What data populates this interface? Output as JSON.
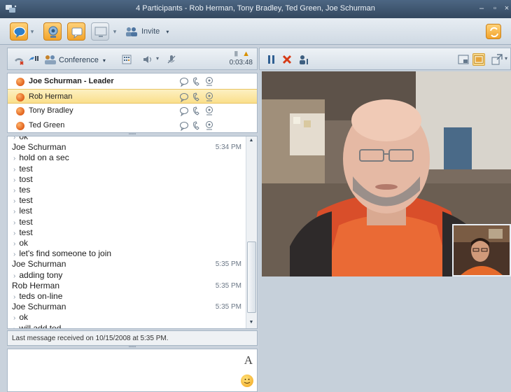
{
  "window": {
    "title": "4 Participants - Rob Herman, Tony Bradley, Ted Green, Joe Schurman"
  },
  "toolbar": {
    "invite_label": "Invite"
  },
  "call_toolbar": {
    "conference_label": "Conference",
    "duration": "0:03:48"
  },
  "participants": [
    {
      "name": "Joe Schurman - Leader",
      "bold": true,
      "selected": false
    },
    {
      "name": "Rob Herman",
      "bold": false,
      "selected": true
    },
    {
      "name": "Tony Bradley",
      "bold": false,
      "selected": false
    },
    {
      "name": "Ted Green",
      "bold": false,
      "selected": false
    }
  ],
  "conversation": {
    "messages": [
      {
        "type": "line",
        "text": "ok"
      },
      {
        "type": "sender",
        "text": "Joe Schurman",
        "time": "5:34 PM"
      },
      {
        "type": "line",
        "text": "hold on a sec"
      },
      {
        "type": "line",
        "text": "test"
      },
      {
        "type": "line",
        "text": "tost"
      },
      {
        "type": "line",
        "text": "tes"
      },
      {
        "type": "line",
        "text": "test"
      },
      {
        "type": "line",
        "text": "lest"
      },
      {
        "type": "line",
        "text": "test"
      },
      {
        "type": "line",
        "text": "test"
      },
      {
        "type": "line",
        "text": "ok"
      },
      {
        "type": "line",
        "text": "let's find someone to join"
      },
      {
        "type": "sender",
        "text": "Joe Schurman",
        "time": "5:35 PM"
      },
      {
        "type": "line",
        "text": "adding tony"
      },
      {
        "type": "sender",
        "text": "Rob Herman",
        "time": "5:35 PM"
      },
      {
        "type": "line",
        "text": "teds on-line"
      },
      {
        "type": "sender",
        "text": "Joe Schurman",
        "time": "5:35 PM"
      },
      {
        "type": "line",
        "text": "ok"
      },
      {
        "type": "line",
        "text": "will add ted"
      }
    ]
  },
  "status": {
    "last_message": "Last message received on 10/15/2008 at 5:35 PM."
  },
  "compose": {
    "font_label": "A"
  },
  "colors": {
    "accent_orange": "#f2a32a",
    "title_bar": "#3e546d",
    "selected_row": "#fadf8b"
  }
}
